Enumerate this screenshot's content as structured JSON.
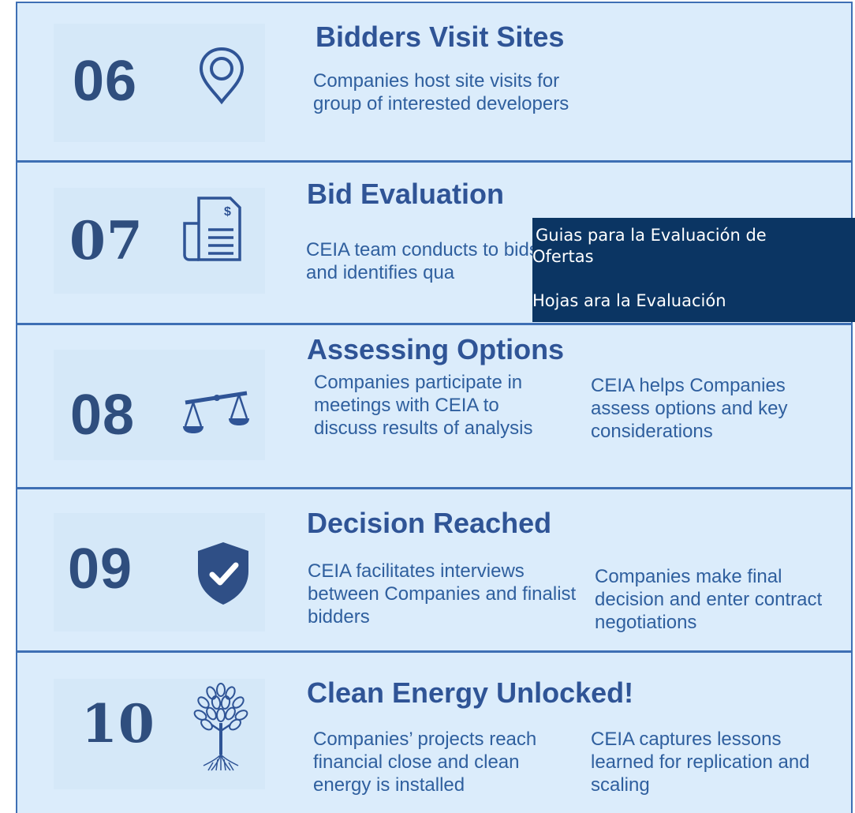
{
  "steps": [
    {
      "number": "06",
      "icon": "location-pin-icon",
      "title": "Bidders Visit Sites",
      "left_text": "Companies host site visits for group of interested developers",
      "right_text": ""
    },
    {
      "number": "07",
      "icon": "invoice-document-icon",
      "title": "Bid Evaluation",
      "left_text": "CEIA team conducts to bids and identifies qua",
      "right_text": ""
    },
    {
      "number": "08",
      "icon": "balance-scale-icon",
      "title": "Assessing Options",
      "left_text": "Companies participate in meetings with CEIA to discuss results of analysis",
      "right_text": "CEIA helps Companies assess options and key considerations"
    },
    {
      "number": "09",
      "icon": "shield-check-icon",
      "title": "Decision Reached",
      "left_text": "CEIA facilitates interviews between Companies and finalist bidders",
      "right_text": "Companies make final decision and enter contract negotiations"
    },
    {
      "number": "10",
      "icon": "tree-icon",
      "title": "Clean Energy Unlocked!",
      "left_text": "Companies’ projects reach financial close and clean energy is installed",
      "right_text": "CEIA captures lessons learned for replication and scaling"
    }
  ],
  "overlay": {
    "line1": "Guias para la Evaluación de",
    "line2": "Ofertas",
    "line3": "Hojas ara la Evaluación"
  },
  "colors": {
    "background": "#dbecfb",
    "border": "#3e6fb4",
    "number": "#2f4e7e",
    "title": "#2f5496",
    "text": "#2f5f9e",
    "overlay": "#0b3563"
  }
}
